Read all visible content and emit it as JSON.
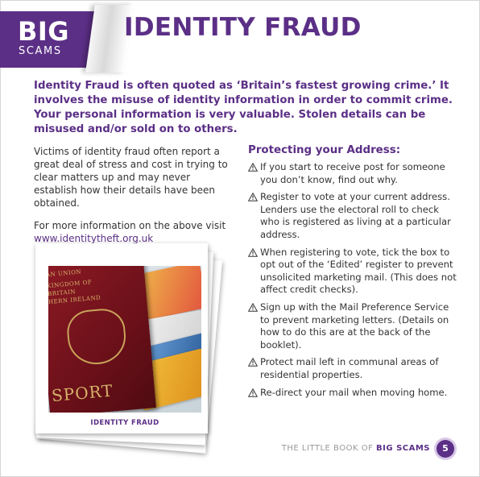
{
  "badge": {
    "big": "BIG",
    "scams": "SCAMS"
  },
  "title": "IDENTITY FRAUD",
  "intro": "Identity Fraud is often quoted as ‘Britain’s fastest growing crime.’ It involves the misuse of identity information in order to commit crime. Your personal information is very valuable. Stolen details can be misused and/or sold on to others.",
  "left": {
    "para1": "Victims of identity fraud often report a great deal of stress and cost in trying to clear matters up and may never establish how their details have been obtained.",
    "para2": "For more information on the above visit",
    "link": "www.identitytheft.org.uk"
  },
  "photo": {
    "caption": "IDENTITY FRAUD",
    "passport_lines": [
      "AN UNION",
      "KINGDOM OF",
      "BRITAIN",
      "HERN IRELAND"
    ],
    "passport_word": "SPORT"
  },
  "right": {
    "heading": "Protecting your Address:",
    "tips": [
      "If you start to receive post for someone you don’t know, find out why.",
      "Register to vote at your current address. Lenders use the electoral roll to check who is registered as living at a particular address.",
      "When registering to vote, tick the box to opt out of the ‘Edited’ register to prevent unsolicited marketing mail. (This does not affect credit checks).",
      "Sign up with the Mail Preference Service to prevent marketing letters. (Details on how to do this are at the back of the booklet).",
      "Protect mail left in communal areas of residential properties.",
      "Re-direct your mail when moving home."
    ]
  },
  "footer": {
    "prefix": "THE LITTLE BOOK OF ",
    "bold": "BIG SCAMS",
    "page": "5"
  },
  "colors": {
    "accent": "#5b2f86"
  },
  "icons": {
    "tip": "warning-triangle-icon"
  }
}
